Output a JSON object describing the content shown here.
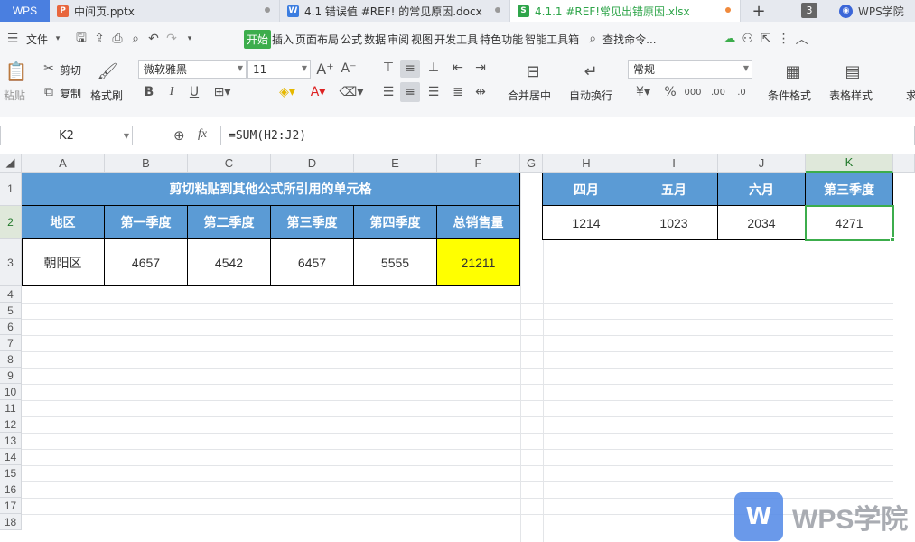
{
  "tabs": {
    "app": "WPS",
    "docs": [
      {
        "name": "中间页.pptx",
        "icon": "P",
        "color": "#e8663d"
      },
      {
        "name": "4.1 错误值 #REF! 的常见原因.docx",
        "icon": "W",
        "color": "#3b7de0"
      },
      {
        "name": "4.1.1 #REF!常见出错原因.xlsx",
        "icon": "S",
        "color": "#2fa54a"
      }
    ],
    "plus": "+",
    "count": "3",
    "academy": "WPS学院"
  },
  "menu": {
    "file": "文件",
    "items": [
      "开始",
      "插入",
      "页面布局",
      "公式",
      "数据",
      "审阅",
      "视图",
      "开发工具",
      "特色功能",
      "智能工具箱"
    ],
    "search": "查找命令..."
  },
  "ribbon": {
    "paste": "粘贴",
    "cut": "剪切",
    "copy": "复制",
    "format_painter": "格式刷",
    "font": "微软雅黑",
    "size": "11",
    "merge": "合并居中",
    "wrap": "自动换行",
    "number_format": "常规",
    "cond_format": "条件格式",
    "table_style": "表格样式",
    "more": "求"
  },
  "formula": {
    "cell": "K2",
    "fx": "fx",
    "content": "=SUM(H2:J2)"
  },
  "columns": [
    "A",
    "B",
    "C",
    "D",
    "E",
    "F",
    "G",
    "H",
    "I",
    "J",
    "K"
  ],
  "rows": [
    "1",
    "2",
    "3",
    "4",
    "5",
    "6",
    "7",
    "8",
    "9",
    "10",
    "11",
    "12",
    "13",
    "14",
    "15",
    "16",
    "17",
    "18"
  ],
  "table1": {
    "title": "剪切粘贴到其他公式所引用的单元格",
    "headers": [
      "地区",
      "第一季度",
      "第二季度",
      "第三季度",
      "第四季度",
      "总销售量"
    ],
    "row": [
      "朝阳区",
      "4657",
      "4542",
      "6457",
      "5555",
      "21211"
    ],
    "highlight": "#ffff00",
    "header_color": "#5b9bd5"
  },
  "table2": {
    "headers": [
      "四月",
      "五月",
      "六月",
      "第三季度"
    ],
    "values": [
      "1214",
      "1023",
      "2034",
      "4271"
    ]
  },
  "watermark": "WPS学院"
}
